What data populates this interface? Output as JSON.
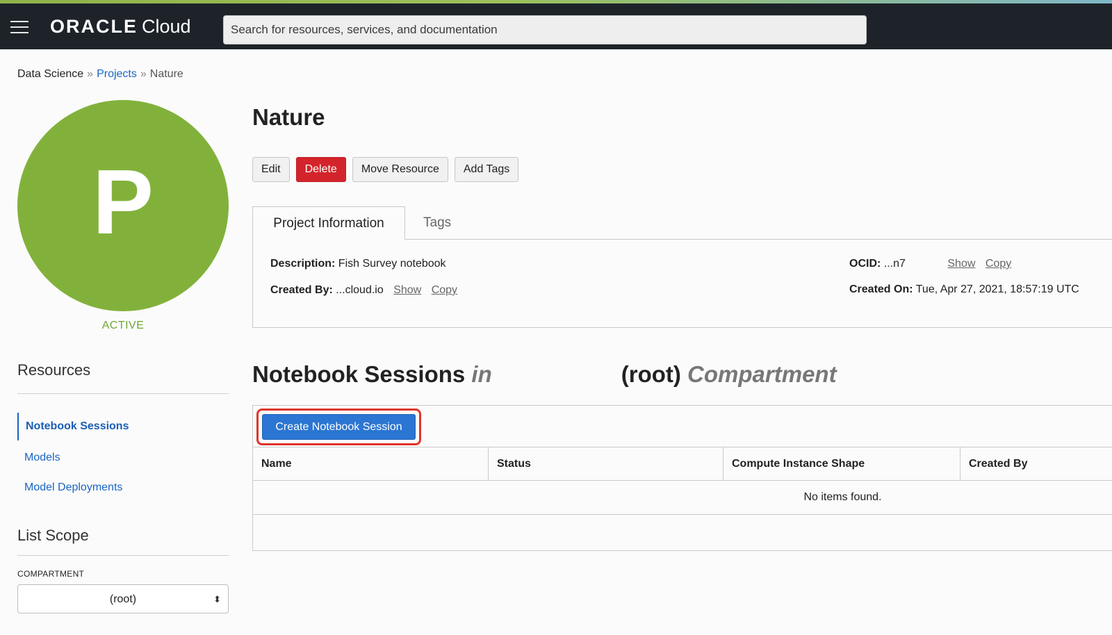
{
  "header": {
    "brand": "ORACLE",
    "product": "Cloud",
    "search_placeholder": "Search for resources, services, and documentation"
  },
  "breadcrumb": {
    "root": "Data Science",
    "separator": "»",
    "projects": "Projects",
    "current": "Nature"
  },
  "project": {
    "avatar_letter": "P",
    "status": "ACTIVE",
    "title": "Nature"
  },
  "actions": {
    "edit": "Edit",
    "delete": "Delete",
    "move": "Move Resource",
    "add_tags": "Add Tags"
  },
  "tabs": {
    "info": "Project Information",
    "tags": "Tags"
  },
  "info": {
    "description_label": "Description:",
    "description_value": "Fish Survey notebook",
    "created_by_label": "Created By:",
    "created_by_value": "...cloud.io",
    "ocid_label": "OCID:",
    "ocid_value": "...n7",
    "created_on_label": "Created On:",
    "created_on_value": "Tue, Apr 27, 2021, 18:57:19 UTC",
    "show": "Show",
    "copy": "Copy"
  },
  "sidebar": {
    "resources_title": "Resources",
    "items": [
      "Notebook Sessions",
      "Models",
      "Model Deployments"
    ],
    "list_scope_title": "List Scope",
    "compartment_label": "COMPARTMENT",
    "compartment_value": "(root)"
  },
  "notebook_sessions": {
    "heading_main": "Notebook Sessions",
    "heading_in": "in",
    "heading_root": "(root)",
    "heading_compartment": "Compartment",
    "create_button": "Create Notebook Session",
    "columns": [
      "Name",
      "Status",
      "Compute Instance Shape",
      "Created By"
    ],
    "empty_message": "No items found."
  },
  "colors": {
    "accent_green": "#82b13b",
    "delete_red": "#d3242b",
    "primary_blue": "#2b76d2",
    "link_blue": "#1a66c2",
    "highlight_red": "#e0342a"
  }
}
